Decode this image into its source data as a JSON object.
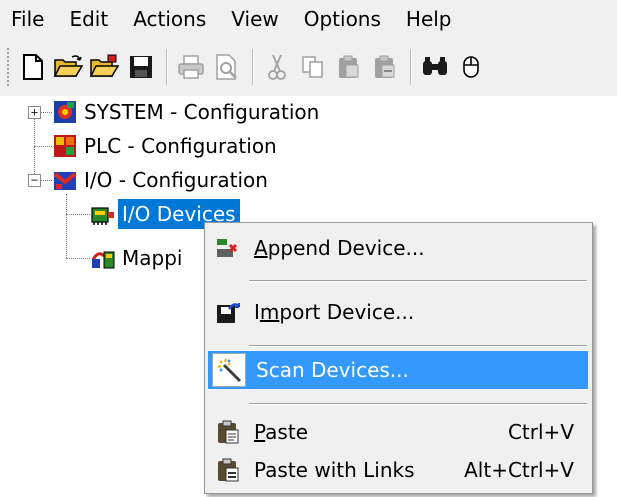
{
  "menubar": {
    "items": [
      "File",
      "Edit",
      "Actions",
      "View",
      "Options",
      "Help"
    ]
  },
  "toolbar": {
    "buttons": [
      "new-file-icon",
      "open-folder-icon",
      "open-project-icon",
      "save-icon",
      "print-icon",
      "print-preview-icon",
      "cut-icon",
      "copy-icon",
      "paste-icon",
      "paste-links-icon",
      "find-icon",
      "mouse-icon"
    ]
  },
  "tree": {
    "system": "SYSTEM - Configuration",
    "plc": "PLC - Configuration",
    "io": "I/O - Configuration",
    "io_devices": "I/O Devices",
    "mappings": "Mappi"
  },
  "context_menu": {
    "append": {
      "accel": "A",
      "rest": "ppend Device..."
    },
    "import": {
      "pre": "I",
      "accel": "m",
      "rest": "port Device..."
    },
    "scan": "Scan Devices...",
    "paste": {
      "accel": "P",
      "rest": "aste",
      "shortcut": "Ctrl+V"
    },
    "paste_links": {
      "label": "Paste with Links",
      "shortcut": "Alt+Ctrl+V"
    }
  },
  "colors": {
    "selection": "#0078d7",
    "menu_highlight": "#3399ff",
    "menu_bg": "#f0f0f0"
  }
}
